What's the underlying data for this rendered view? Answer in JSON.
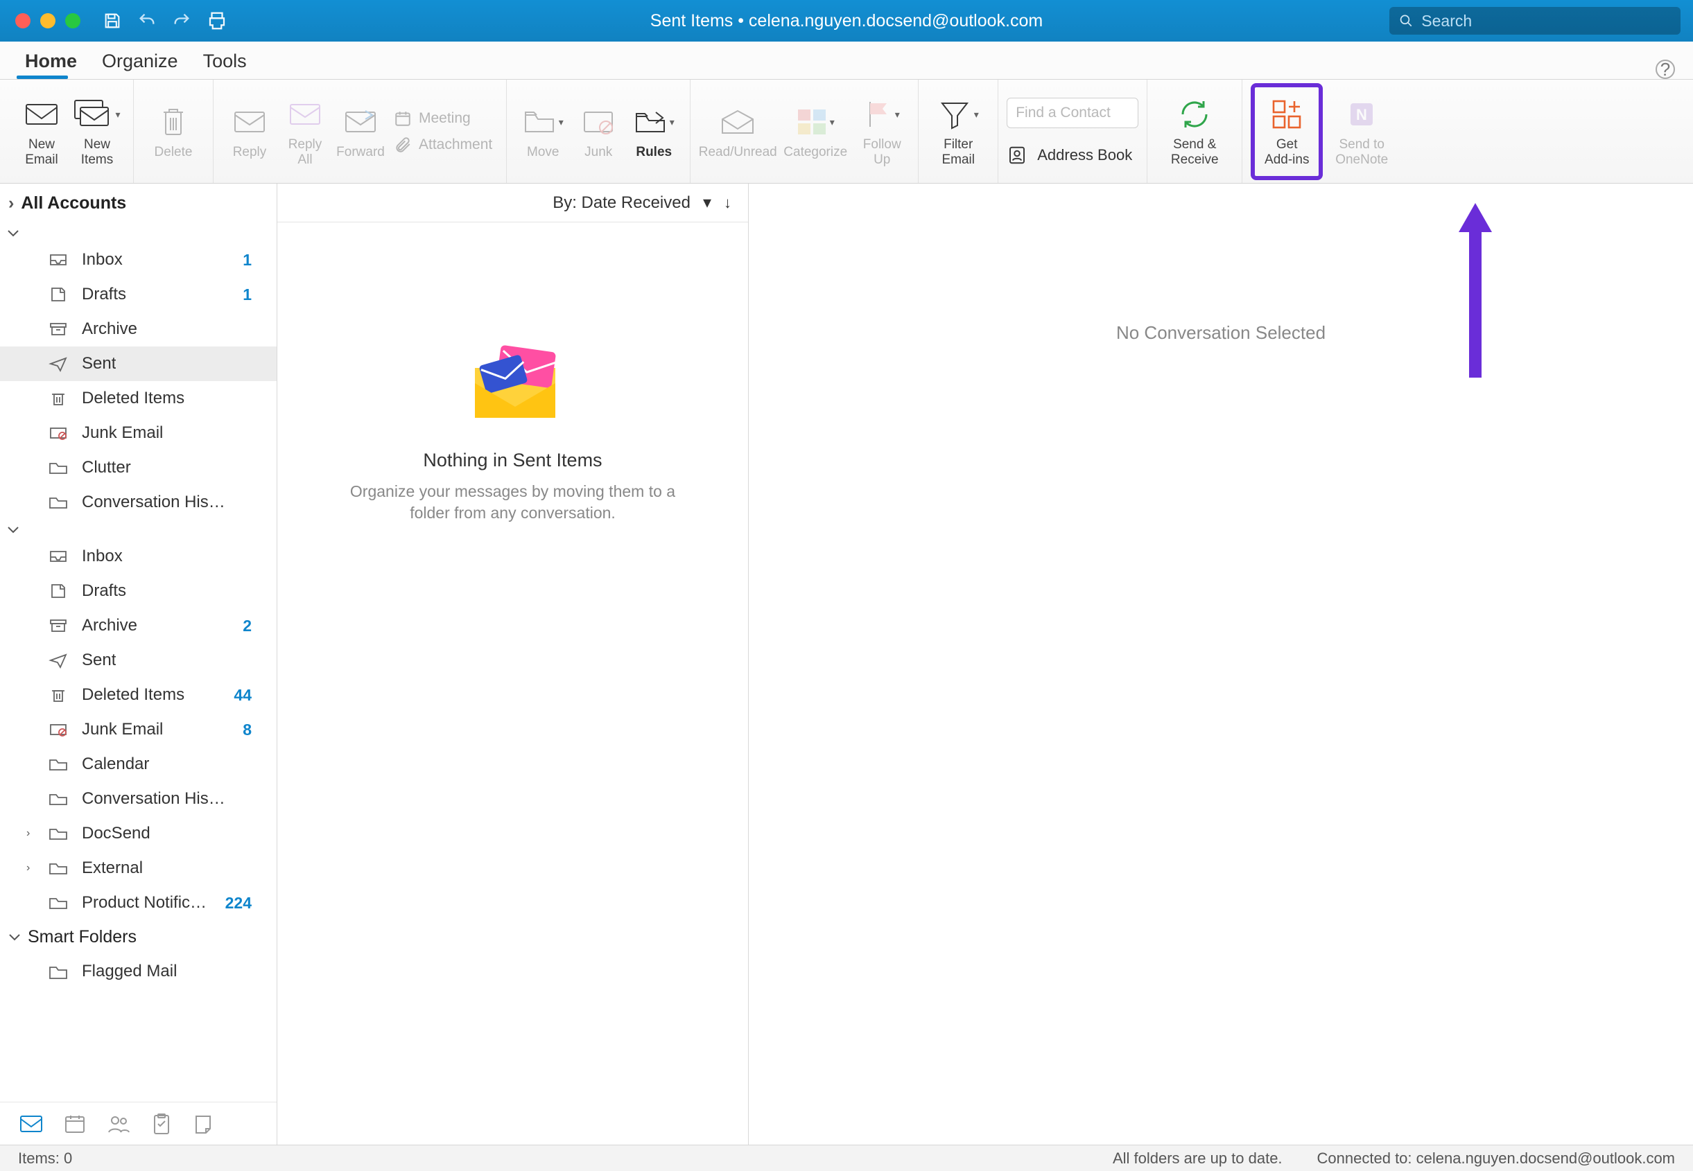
{
  "window": {
    "title": "Sent Items • celena.nguyen.docsend@outlook.com",
    "search_placeholder": "Search"
  },
  "tabs": {
    "home": "Home",
    "organize": "Organize",
    "tools": "Tools"
  },
  "ribbon": {
    "new_email": "New\nEmail",
    "new_items": "New\nItems",
    "delete": "Delete",
    "reply": "Reply",
    "reply_all": "Reply\nAll",
    "forward": "Forward",
    "meeting": "Meeting",
    "attachment": "Attachment",
    "move": "Move",
    "junk": "Junk",
    "rules": "Rules",
    "read_unread": "Read/Unread",
    "categorize": "Categorize",
    "follow_up": "Follow\nUp",
    "filter_email": "Filter\nEmail",
    "find_contact_placeholder": "Find a Contact",
    "address_book": "Address Book",
    "send_receive": "Send &\nReceive",
    "get_addins": "Get\nAdd-ins",
    "send_onenote": "Send to\nOneNote"
  },
  "sidebar": {
    "all_accounts": "All Accounts",
    "account1": [
      {
        "name": "Inbox",
        "count": "1"
      },
      {
        "name": "Drafts",
        "count": "1"
      },
      {
        "name": "Archive",
        "count": ""
      },
      {
        "name": "Sent",
        "count": "",
        "selected": true
      },
      {
        "name": "Deleted Items",
        "count": ""
      },
      {
        "name": "Junk Email",
        "count": ""
      },
      {
        "name": "Clutter",
        "count": ""
      },
      {
        "name": "Conversation History",
        "count": ""
      }
    ],
    "account2": [
      {
        "name": "Inbox",
        "count": ""
      },
      {
        "name": "Drafts",
        "count": ""
      },
      {
        "name": "Archive",
        "count": "2"
      },
      {
        "name": "Sent",
        "count": ""
      },
      {
        "name": "Deleted Items",
        "count": "44"
      },
      {
        "name": "Junk Email",
        "count": "8"
      },
      {
        "name": "Calendar",
        "count": ""
      },
      {
        "name": "Conversation History",
        "count": ""
      },
      {
        "name": "DocSend",
        "count": "",
        "expandable": true
      },
      {
        "name": "External",
        "count": "",
        "expandable": true
      },
      {
        "name": "Product Notific…",
        "count": "224"
      }
    ],
    "smart_folders": "Smart Folders",
    "flagged_mail": "Flagged Mail"
  },
  "listpane": {
    "sort_label": "By: Date Received",
    "empty_title": "Nothing in Sent Items",
    "empty_sub": "Organize your messages by moving them to a folder from any conversation."
  },
  "readpane": {
    "empty": "No Conversation Selected"
  },
  "status": {
    "items": "Items: 0",
    "uptodate": "All folders are up to date.",
    "connected": "Connected to: celena.nguyen.docsend@outlook.com"
  }
}
